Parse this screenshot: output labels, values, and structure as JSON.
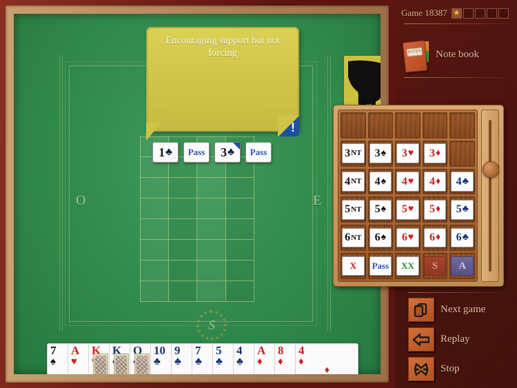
{
  "game": {
    "label": "Game 18387",
    "stars_total": 5,
    "stars_filled": 1,
    "star_glyph": "★"
  },
  "notebook": {
    "label": "Note book",
    "cover_text": "NOTES",
    "icon": "notebook-icon"
  },
  "tooltip": {
    "text": "Encouraging support but not forcing",
    "badge": "!",
    "badge_color": "#1b4fa8",
    "background_color": "#d2c647"
  },
  "hand_cursor": {
    "icon": "pointing-hand-icon",
    "tile_color": "#cfc33f"
  },
  "table": {
    "compass_west": "O",
    "compass_east": "E",
    "center_emblem": "S",
    "felt_color": "#2f8a4b"
  },
  "bid_sequence": [
    {
      "level": "1",
      "suit": "♣",
      "suit_class": "suit-c",
      "type": "bid",
      "flag": false
    },
    {
      "level": "",
      "suit": "",
      "suit_class": "",
      "type": "pass",
      "label": "Pass",
      "flag": false
    },
    {
      "level": "3",
      "suit": "♣",
      "suit_class": "suit-c",
      "type": "bid",
      "flag": true
    },
    {
      "level": "",
      "suit": "",
      "suit_class": "",
      "type": "pass",
      "label": "Pass",
      "flag": false
    }
  ],
  "bidding_box": {
    "rows": [
      [
        {
          "kind": "empty"
        },
        {
          "kind": "empty"
        },
        {
          "kind": "empty"
        },
        {
          "kind": "empty"
        },
        {
          "kind": "empty"
        }
      ],
      [
        {
          "kind": "bid",
          "level": "3",
          "denom": "NT",
          "denom_type": "nt",
          "color": "blk"
        },
        {
          "kind": "bid",
          "level": "3",
          "denom": "♠",
          "denom_type": "suit",
          "color": "blk"
        },
        {
          "kind": "bid",
          "level": "3",
          "denom": "♥",
          "denom_type": "suit",
          "color": "red"
        },
        {
          "kind": "bid",
          "level": "3",
          "denom": "♦",
          "denom_type": "suit",
          "color": "red"
        },
        {
          "kind": "empty"
        }
      ],
      [
        {
          "kind": "bid",
          "level": "4",
          "denom": "NT",
          "denom_type": "nt",
          "color": "blk"
        },
        {
          "kind": "bid",
          "level": "4",
          "denom": "♠",
          "denom_type": "suit",
          "color": "blk"
        },
        {
          "kind": "bid",
          "level": "4",
          "denom": "♥",
          "denom_type": "suit",
          "color": "red"
        },
        {
          "kind": "bid",
          "level": "4",
          "denom": "♦",
          "denom_type": "suit",
          "color": "red"
        },
        {
          "kind": "bid",
          "level": "4",
          "denom": "♣",
          "denom_type": "suit",
          "color": "blu"
        }
      ],
      [
        {
          "kind": "bid",
          "level": "5",
          "denom": "NT",
          "denom_type": "nt",
          "color": "blk"
        },
        {
          "kind": "bid",
          "level": "5",
          "denom": "♠",
          "denom_type": "suit",
          "color": "blk"
        },
        {
          "kind": "bid",
          "level": "5",
          "denom": "♥",
          "denom_type": "suit",
          "color": "red"
        },
        {
          "kind": "bid",
          "level": "5",
          "denom": "♦",
          "denom_type": "suit",
          "color": "red"
        },
        {
          "kind": "bid",
          "level": "5",
          "denom": "♣",
          "denom_type": "suit",
          "color": "blu"
        }
      ],
      [
        {
          "kind": "bid",
          "level": "6",
          "denom": "NT",
          "denom_type": "nt",
          "color": "blk"
        },
        {
          "kind": "bid",
          "level": "6",
          "denom": "♠",
          "denom_type": "suit",
          "color": "blk"
        },
        {
          "kind": "bid",
          "level": "6",
          "denom": "♥",
          "denom_type": "suit",
          "color": "red"
        },
        {
          "kind": "bid",
          "level": "6",
          "denom": "♦",
          "denom_type": "suit",
          "color": "red"
        },
        {
          "kind": "bid",
          "level": "6",
          "denom": "♣",
          "denom_type": "suit",
          "color": "blu"
        }
      ],
      [
        {
          "kind": "text",
          "label": "X",
          "color": "#cc1111",
          "style": "card"
        },
        {
          "kind": "text",
          "label": "Pass",
          "color": "#2b53b8",
          "style": "card"
        },
        {
          "kind": "text",
          "label": "XX",
          "color": "#1d8a2a",
          "style": "card"
        },
        {
          "kind": "text",
          "label": "S",
          "color": "#d59a8a",
          "style": "flat-s"
        },
        {
          "kind": "text",
          "label": "A",
          "color": "#d6c4d4",
          "style": "flat-a"
        }
      ]
    ],
    "slider": {
      "name": "bidding-box-scroll-slider",
      "position_percent": 30
    }
  },
  "hand": [
    {
      "rank": "7",
      "suit": "♠",
      "color": "blk",
      "court": false
    },
    {
      "rank": "A",
      "suit": "♥",
      "color": "red",
      "court": false
    },
    {
      "rank": "K",
      "suit": "♥",
      "color": "red",
      "court": true
    },
    {
      "rank": "K",
      "suit": "♣",
      "color": "blu",
      "court": true
    },
    {
      "rank": "Q",
      "suit": "♣",
      "color": "blu",
      "court": true
    },
    {
      "rank": "10",
      "suit": "♣",
      "color": "blu",
      "court": false
    },
    {
      "rank": "9",
      "suit": "♣",
      "color": "blu",
      "court": false
    },
    {
      "rank": "7",
      "suit": "♣",
      "color": "blu",
      "court": false
    },
    {
      "rank": "5",
      "suit": "♣",
      "color": "blu",
      "court": false
    },
    {
      "rank": "4",
      "suit": "♣",
      "color": "blu",
      "court": false
    },
    {
      "rank": "A",
      "suit": "♦",
      "color": "red",
      "court": false
    },
    {
      "rank": "8",
      "suit": "♦",
      "color": "red",
      "court": false
    },
    {
      "rank": "4",
      "suit": "♦",
      "color": "red",
      "court": false,
      "last": true
    }
  ],
  "actions": [
    {
      "label": "Next game",
      "icon": "cards-icon"
    },
    {
      "label": "Replay",
      "icon": "left-arrow-icon"
    },
    {
      "label": "Stop",
      "icon": "x-cross-icon"
    }
  ]
}
